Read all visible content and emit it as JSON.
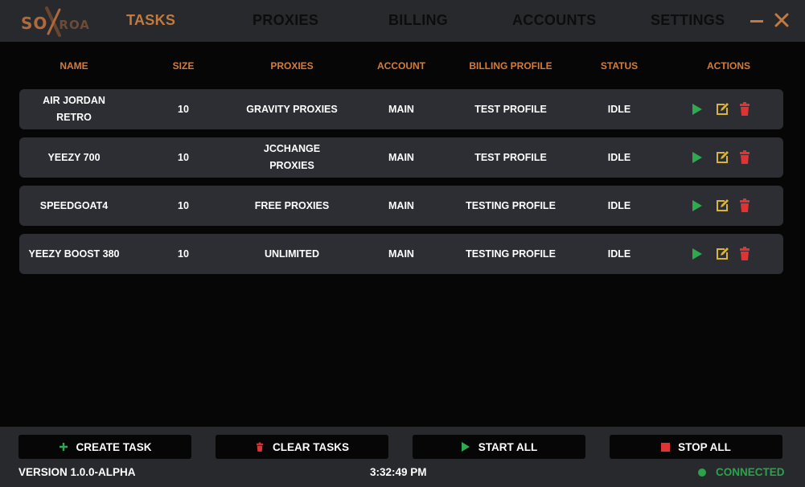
{
  "app": {
    "logo_text": "SO",
    "logo_text_faded": "ROA"
  },
  "nav": {
    "tabs": [
      {
        "label": "TASKS",
        "active": true
      },
      {
        "label": "PROXIES",
        "active": false
      },
      {
        "label": "BILLING",
        "active": false
      },
      {
        "label": "ACCOUNTS",
        "active": false
      },
      {
        "label": "SETTINGS",
        "active": false
      }
    ]
  },
  "window_controls": {
    "minimize_icon": "minus-icon",
    "close_icon": "close-icon",
    "color": "#c27a3f"
  },
  "table": {
    "columns": [
      "NAME",
      "SIZE",
      "PROXIES",
      "ACCOUNT",
      "BILLING PROFILE",
      "STATUS",
      "ACTIONS"
    ],
    "rows": [
      {
        "name": [
          "AIR JORDAN",
          "RETRO"
        ],
        "size": "10",
        "proxies": [
          "GRAVITY PROXIES"
        ],
        "account": "MAIN",
        "billing": "TEST PROFILE",
        "status": "IDLE"
      },
      {
        "name": [
          "YEEZY 700"
        ],
        "size": "10",
        "proxies": [
          "JCCHANGE",
          "PROXIES"
        ],
        "account": "MAIN",
        "billing": "TEST PROFILE",
        "status": "IDLE"
      },
      {
        "name": [
          "SPEEDGOAT4"
        ],
        "size": "10",
        "proxies": [
          "FREE PROXIES"
        ],
        "account": "MAIN",
        "billing": "TESTING PROFILE",
        "status": "IDLE"
      },
      {
        "name": [
          "YEEZY BOOST 380"
        ],
        "size": "10",
        "proxies": [
          "UNLIMITED"
        ],
        "account": "MAIN",
        "billing": "TESTING PROFILE",
        "status": "IDLE"
      }
    ],
    "action_icons": [
      "play-icon",
      "edit-icon",
      "trash-icon"
    ],
    "action_colors": {
      "play": "#2fa84f",
      "edit": "#d8b43a",
      "delete": "#e03434"
    }
  },
  "footer": {
    "buttons": [
      {
        "label": "CREATE TASK",
        "icon": "plus-icon",
        "color": "#2fa84f"
      },
      {
        "label": "CLEAR TASKS",
        "icon": "trash-icon",
        "color": "#e03434"
      },
      {
        "label": "START ALL",
        "icon": "play-icon",
        "color": "#2fa84f"
      },
      {
        "label": "STOP ALL",
        "icon": "stop-icon",
        "color": "#e03434"
      }
    ],
    "version": "VERSION 1.0.0-ALPHA",
    "time": "3:32:49 PM",
    "connection_status": "CONNECTED",
    "connection_color": "#2aa34a"
  },
  "colors": {
    "accent": "#c27a3f",
    "header_text": "#d37d3b",
    "row_bg": "#2c2e33",
    "bar_bg": "#27292d",
    "page_bg": "#060606"
  }
}
